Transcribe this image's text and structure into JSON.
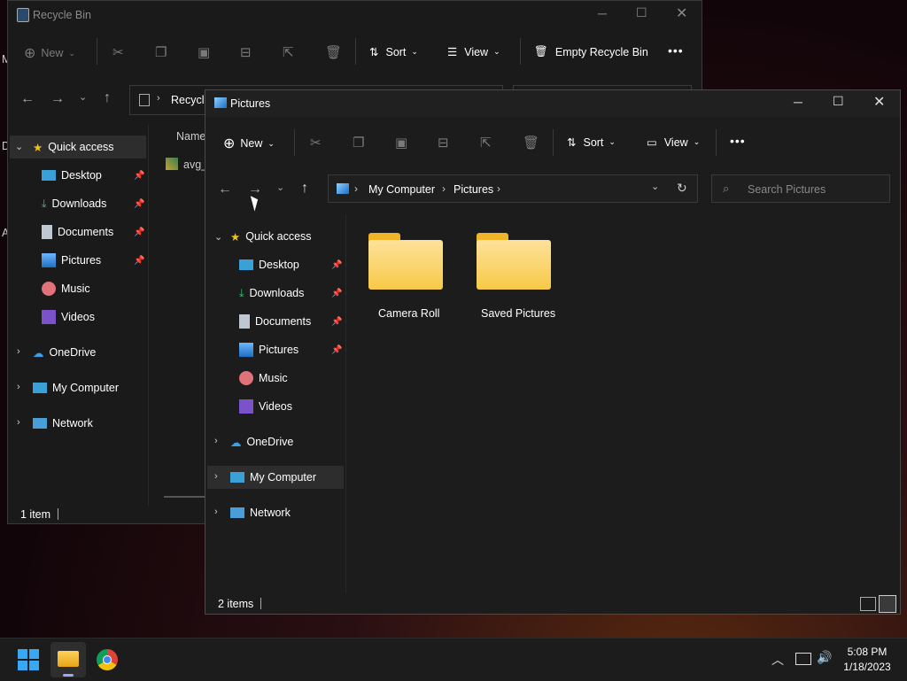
{
  "recycle": {
    "title": "Recycle Bin",
    "toolbar": {
      "new": "New",
      "sort": "Sort",
      "view": "View",
      "empty": "Empty Recycle Bin",
      "more": "•••"
    },
    "address": "Recycle",
    "column_name": "Name",
    "file_name": "avg_",
    "nav": {
      "quick": "Quick access",
      "desktop": "Desktop",
      "downloads": "Downloads",
      "documents": "Documents",
      "pictures": "Pictures",
      "music": "Music",
      "videos": "Videos",
      "onedrive": "OneDrive",
      "mycomputer": "My Computer",
      "network": "Network"
    },
    "status": "1 item",
    "bg_d": "D",
    "bg_m": "M",
    "bg_a": "A"
  },
  "pictures": {
    "title": "Pictures",
    "toolbar": {
      "new": "New",
      "sort": "Sort",
      "view": "View",
      "more": "•••"
    },
    "breadcrumb": [
      "My Computer",
      "Pictures"
    ],
    "search_placeholder": "Search Pictures",
    "nav": {
      "quick": "Quick access",
      "desktop": "Desktop",
      "downloads": "Downloads",
      "documents": "Documents",
      "pictures": "Pictures",
      "music": "Music",
      "videos": "Videos",
      "onedrive": "OneDrive",
      "mycomputer": "My Computer",
      "network": "Network"
    },
    "folders": [
      "Camera Roll",
      "Saved Pictures"
    ],
    "status": "2 items"
  },
  "clock": {
    "time": "5:08 PM",
    "date": "1/18/2023"
  },
  "colors": {
    "accent": "#0078d4",
    "folder": "#f7c948",
    "selected": "#2d2d2d"
  }
}
